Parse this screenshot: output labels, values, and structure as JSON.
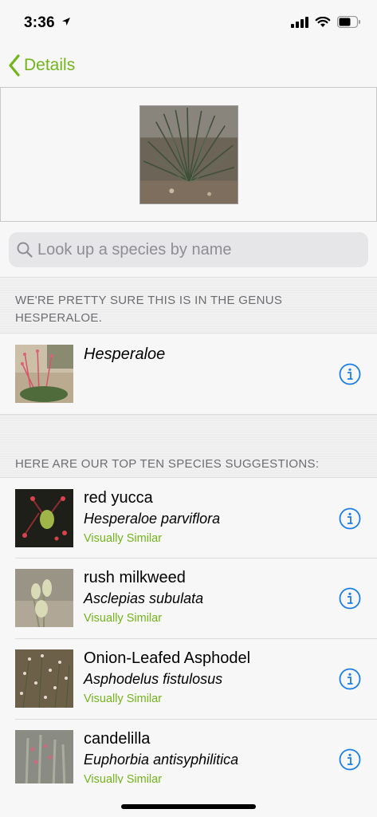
{
  "status": {
    "time": "3:36"
  },
  "nav": {
    "back_label": "Details"
  },
  "search": {
    "placeholder": "Look up a species by name"
  },
  "genus_section": {
    "header": "WE'RE PRETTY SURE THIS IS IN THE GENUS HESPERALOE.",
    "name": "Hesperaloe"
  },
  "species_section": {
    "header": "HERE ARE OUR TOP TEN SPECIES SUGGESTIONS:",
    "items": [
      {
        "common": "red yucca",
        "scientific": "Hesperaloe parviflora",
        "tag": "Visually Similar"
      },
      {
        "common": "rush milkweed",
        "scientific": "Asclepias subulata",
        "tag": "Visually Similar"
      },
      {
        "common": "Onion-Leafed Asphodel",
        "scientific": "Asphodelus fistulosus",
        "tag": "Visually Similar"
      },
      {
        "common": "candelilla",
        "scientific": "Euphorbia antisyphilitica",
        "tag": "Visually Similar"
      }
    ]
  },
  "colors": {
    "accent": "#72b41a",
    "info": "#1a7ee6",
    "header_text": "#6d6d72"
  }
}
